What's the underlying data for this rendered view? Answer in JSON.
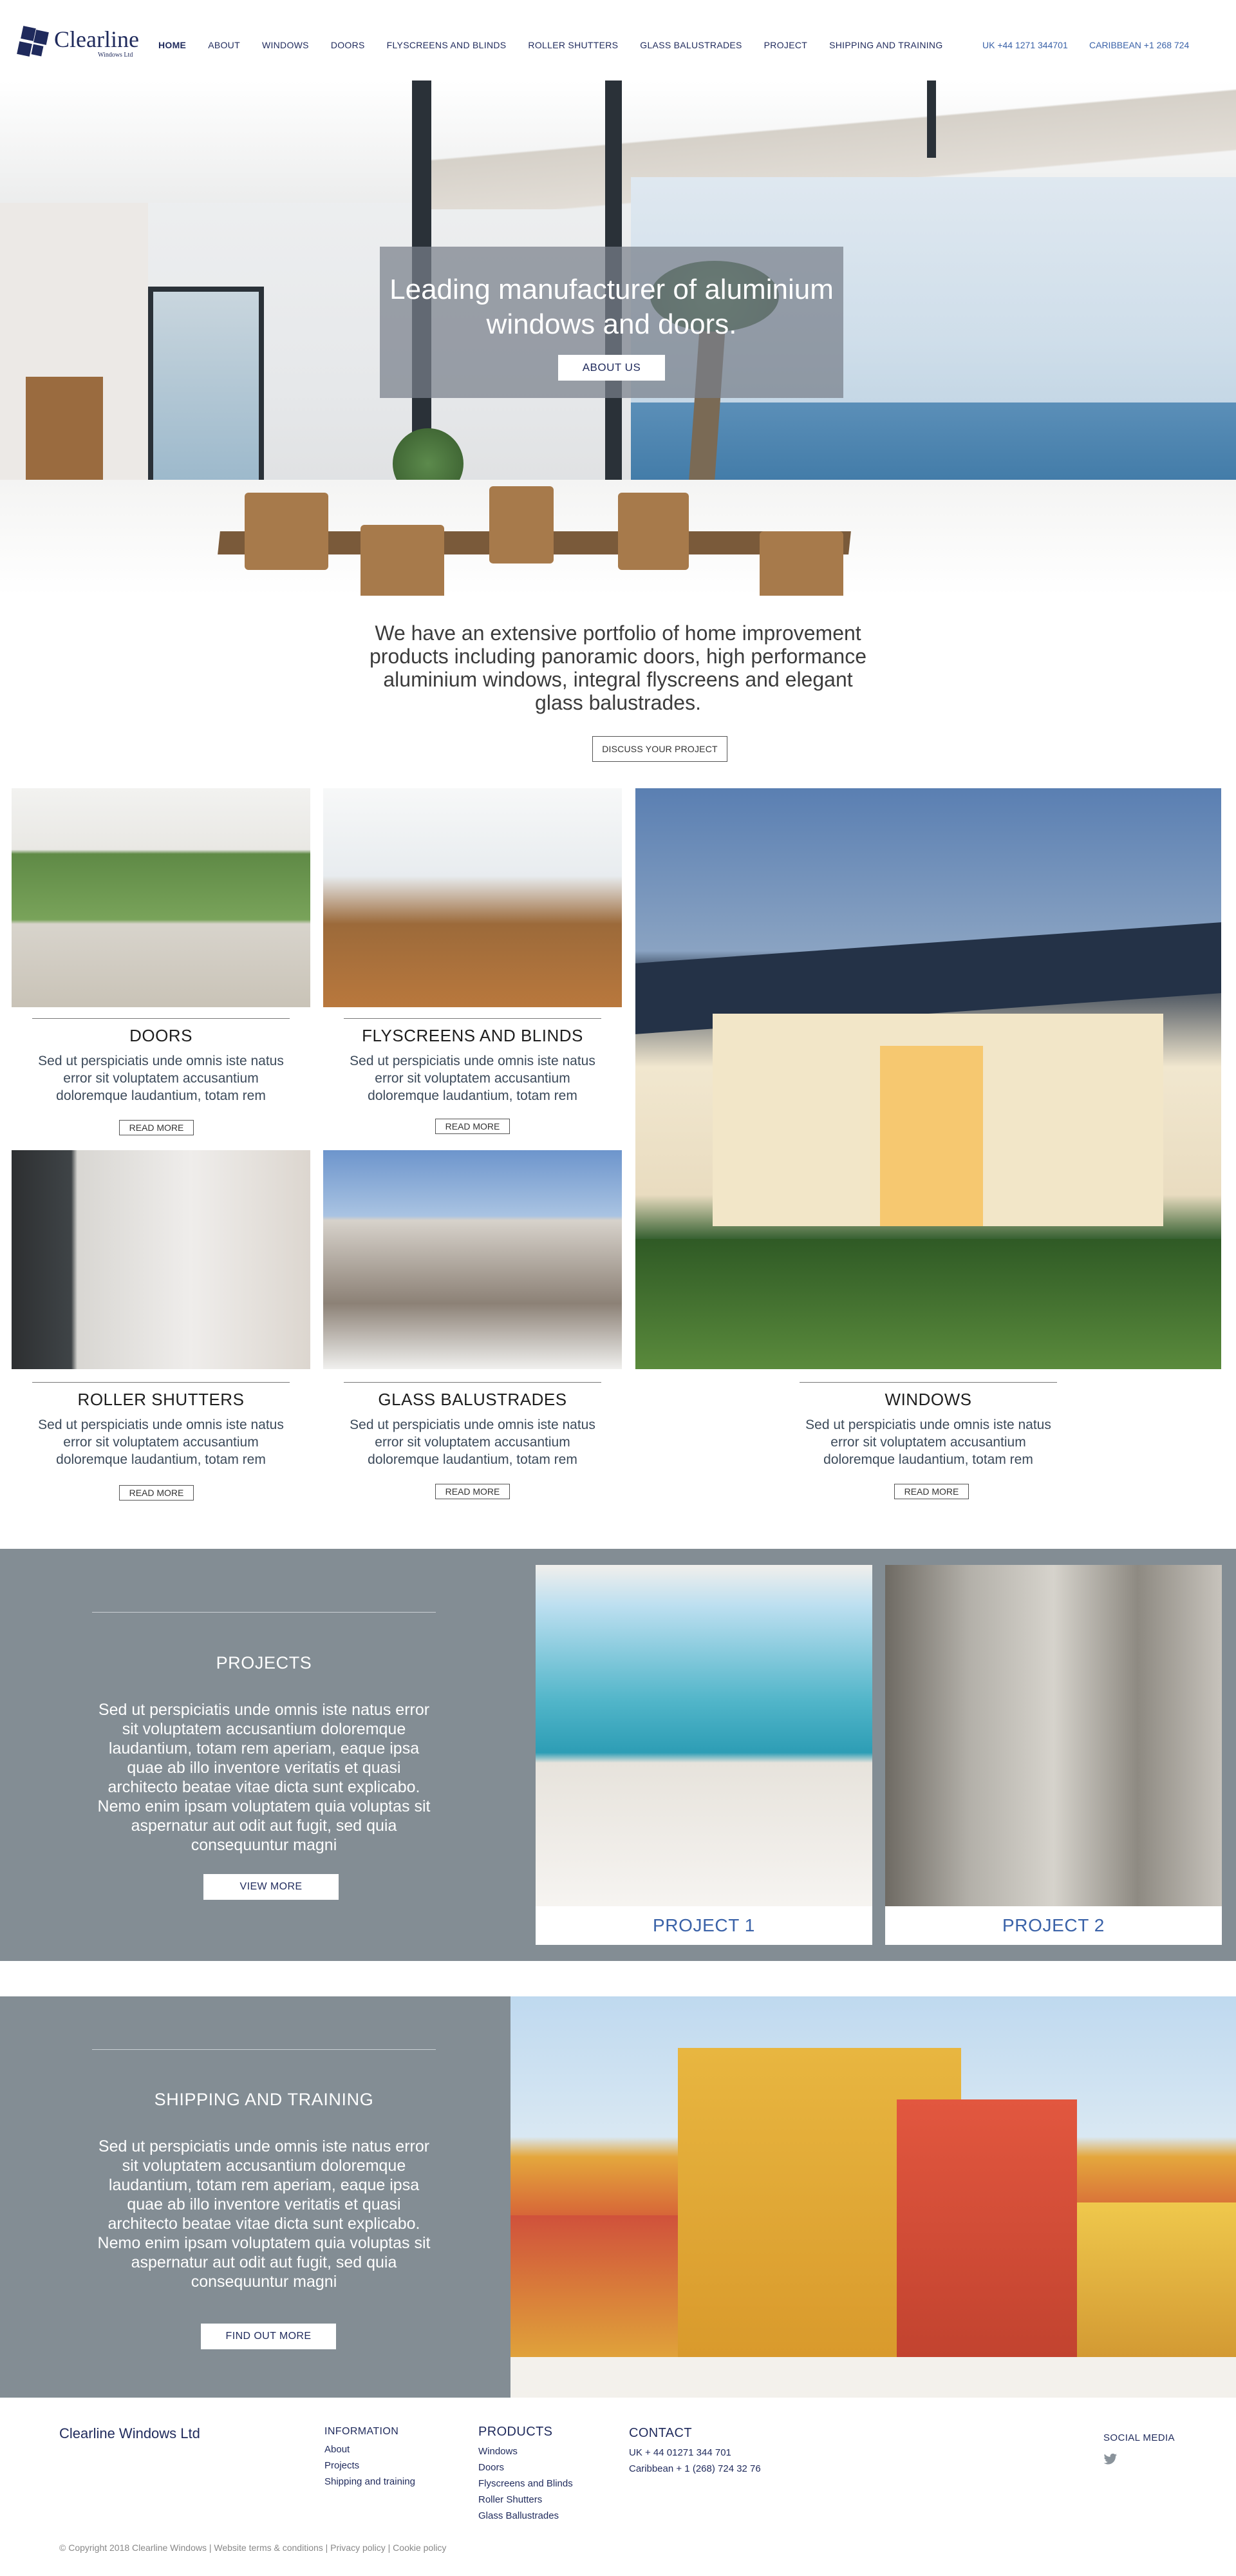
{
  "header": {
    "logo_name": "Clearline",
    "logo_sub": "Windows Ltd",
    "nav": [
      "HOME",
      "ABOUT",
      "WINDOWS",
      "DOORS",
      "FLYSCREENS AND BLINDS",
      "ROLLER SHUTTERS",
      "GLASS BALUSTRADES",
      "PROJECT",
      "SHIPPING AND TRAINING"
    ],
    "contact_uk": "UK +44 1271 344701",
    "contact_caribbean": "CARIBBEAN +1 268 724"
  },
  "hero": {
    "title": "Leading manufacturer of aluminium windows and doors.",
    "button": "ABOUT US"
  },
  "intro": {
    "text": "We have an extensive portfolio of home improvement products including panoramic doors, high performance aluminium windows, integral flyscreens and elegant glass balustrades.",
    "button": "DISCUSS YOUR PROJECT"
  },
  "products": [
    {
      "title": "DOORS",
      "desc": "Sed ut perspiciatis unde omnis iste natus error sit voluptatem accusantium doloremque laudantium, totam rem",
      "button": "READ MORE"
    },
    {
      "title": "FLYSCREENS AND BLINDS",
      "desc": "Sed ut perspiciatis unde omnis iste natus error sit voluptatem accusantium doloremque laudantium, totam rem",
      "button": "READ MORE"
    },
    {
      "title": "ROLLER SHUTTERS",
      "desc": "Sed ut perspiciatis unde omnis iste natus error sit voluptatem accusantium doloremque laudantium, totam rem",
      "button": "READ MORE"
    },
    {
      "title": "GLASS BALUSTRADES",
      "desc": "Sed ut perspiciatis unde omnis iste natus error sit voluptatem accusantium doloremque laudantium, totam rem",
      "button": "READ MORE"
    },
    {
      "title": "WINDOWS",
      "desc": "Sed ut perspiciatis unde omnis iste natus error sit voluptatem accusantium doloremque laudantium, totam rem",
      "button": "READ MORE"
    }
  ],
  "projects": {
    "title": "PROJECTS",
    "desc": "Sed ut perspiciatis unde omnis iste natus error sit voluptatem accusantium doloremque laudantium, totam rem aperiam, eaque ipsa quae ab illo inventore veritatis et quasi architecto beatae vitae dicta sunt explicabo. Nemo enim ipsam voluptatem quia voluptas sit aspernatur aut odit aut fugit, sed quia consequuntur magni",
    "button": "VIEW MORE",
    "cards": [
      "PROJECT 1",
      "PROJECT 2"
    ]
  },
  "shipping": {
    "title": "SHIPPING AND TRAINING",
    "desc": "Sed ut perspiciatis unde omnis iste natus error sit voluptatem accusantium doloremque laudantium, totam rem aperiam, eaque ipsa quae ab illo inventore veritatis et quasi architecto beatae vitae dicta sunt explicabo. Nemo enim ipsam voluptatem quia voluptas sit aspernatur aut odit aut fugit, sed quia consequuntur magni",
    "button": "FIND OUT MORE"
  },
  "footer": {
    "brand": "Clearline Windows Ltd",
    "information": {
      "heading": "INFORMATION",
      "items": [
        "About",
        "Projects",
        "Shipping and training"
      ]
    },
    "products": {
      "heading": "PRODUCTS",
      "items": [
        "Windows",
        "Doors",
        "Flyscreens and Blinds",
        "Roller Shutters",
        "Glass Ballustrades"
      ]
    },
    "contact": {
      "heading": "CONTACT",
      "items": [
        "UK + 44 01271 344 701",
        "Caribbean + 1 (268) 724 32 76"
      ]
    },
    "social_heading": "SOCIAL MEDIA",
    "copyright": "© Copyright 2018 Clearline Windows | Website terms & conditions | Privacy policy | Cookie policy"
  },
  "colors": {
    "brand_navy": "#1f2a5c",
    "accent_blue": "#3a62a8",
    "section_grey": "#838d94"
  },
  "icons": {
    "social": "twitter-icon"
  }
}
